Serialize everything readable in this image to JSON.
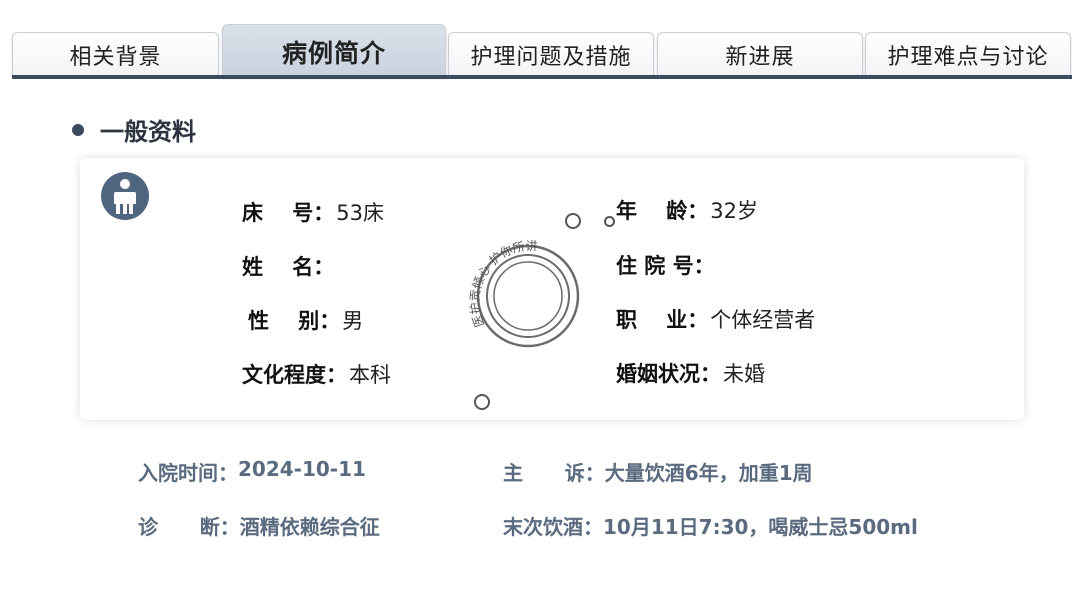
{
  "tabs": [
    {
      "label": "相关背景",
      "active": false
    },
    {
      "label": "病例简介",
      "active": true
    },
    {
      "label": "护理问题及措施",
      "active": false
    },
    {
      "label": "新进展",
      "active": false
    },
    {
      "label": "护理难点与讨论",
      "active": false
    }
  ],
  "section_title": "一般资料",
  "patient": {
    "bed_label": "床    号：",
    "bed_value": "53床",
    "age_label": "年    龄：",
    "age_value": "32岁",
    "name_label": "姓    名：",
    "name_value": "",
    "admission_no_label": "住 院 号：",
    "admission_no_value": "",
    "gender_label": "性    别：",
    "gender_value": "男",
    "job_label": "职    业：",
    "job_value": "个体经营者",
    "education_label": "文化程度：",
    "education_value": "本科",
    "marital_label": "婚姻状况：",
    "marital_value": "未婚"
  },
  "watermark": "医护贡倾心 护你所讲",
  "summary": {
    "admit_time_label": "入院时间：",
    "admit_time_value": "2024-10-11",
    "complaint_label": "主      诉：",
    "complaint_value": "大量饮酒6年，加重1周",
    "diagnosis_label": "诊      断：",
    "diagnosis_value": "酒精依赖综合征",
    "last_drink_label": "末次饮酒：",
    "last_drink_value": "10月11日7:30，喝威士忌500ml"
  },
  "colors": {
    "accent_dark": "#3b4a5c",
    "summary_text": "#5a6b7f",
    "active_tab": "#c8d2dd",
    "icon": "#4f6580"
  }
}
